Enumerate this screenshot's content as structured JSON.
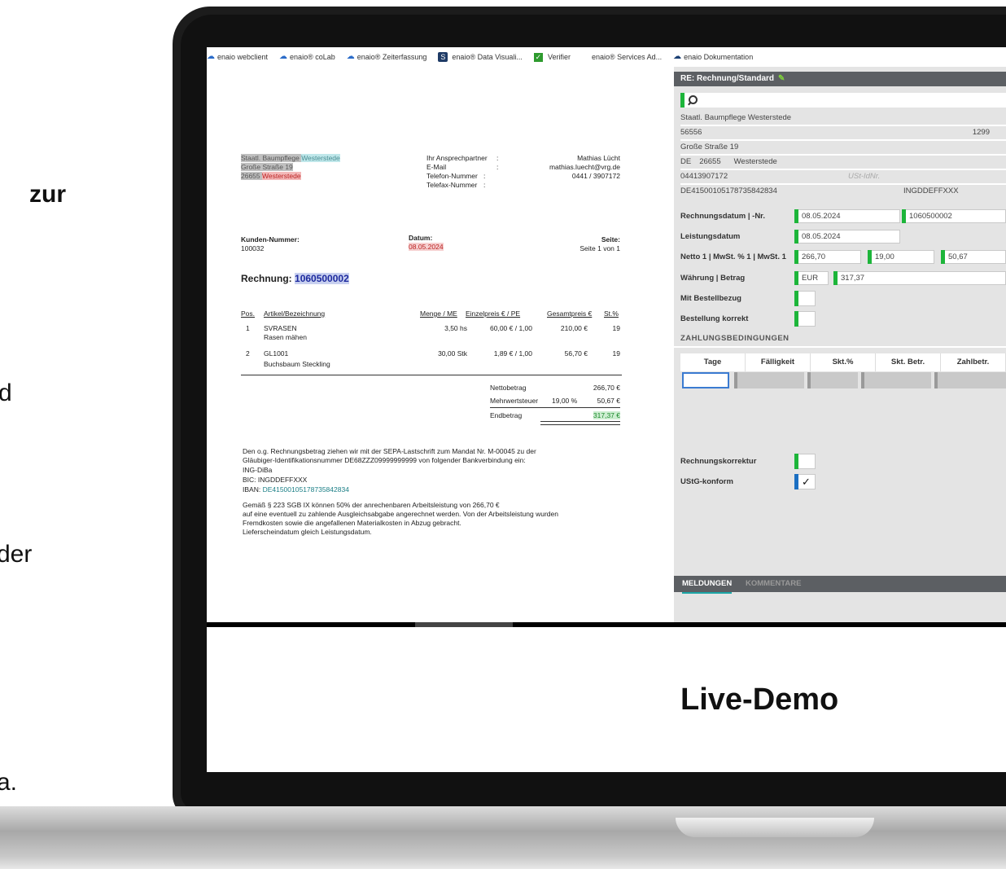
{
  "slide_fragments": [
    "zur",
    "d",
    "der",
    "a."
  ],
  "bookmarks": [
    {
      "label": "enaio webclient",
      "icon": "enaio-icon"
    },
    {
      "label": "enaio® coLab",
      "icon": "enaio-icon"
    },
    {
      "label": "enaio® Zeiterfassung",
      "icon": "enaio-icon"
    },
    {
      "label": "enaio® Data Visuali...",
      "icon": "data-visualization-icon"
    },
    {
      "label": "Verifier",
      "icon": "check-icon"
    },
    {
      "label": "enaio® Services Ad...",
      "icon": "none"
    },
    {
      "label": "enaio Dokumentation",
      "icon": "enaio-icon"
    }
  ],
  "document": {
    "sender": {
      "line1_a": "Staatl. Baumpflege ",
      "line1_b": "Westerstede",
      "line2": "Große Straße 19",
      "line3_a": "26655 ",
      "line3_b": "Westerstede"
    },
    "contact_labels": {
      "partner": "Ihr Ansprechpartner",
      "email": "E-Mail",
      "phone": "Telefon-Nummer",
      "fax": "Telefax-Nummer",
      "colon": ":"
    },
    "contact_values": {
      "partner": "Mathias Lücht",
      "email": "mathias.luecht@vrg.de",
      "phone": "0441 / 3907172"
    },
    "customer_label": "Kunden-Nummer:",
    "customer_value": "100032",
    "date_label": "Datum:",
    "date_value": "08.05.2024",
    "page_label": "Seite:",
    "page_value": "Seite 1 von 1",
    "invoice_label": "Rechnung:",
    "invoice_number": "1060500002",
    "table_headers": {
      "pos": "Pos.",
      "article": "Artikel/Bezeichnung",
      "qty": "Menge / ME",
      "unit_price": "Einzelpreis € / PE",
      "total": "Gesamtpreis €",
      "tax": "St.%"
    },
    "items": [
      {
        "pos": "1",
        "article": "SVRASEN",
        "desc": "Rasen mähen",
        "qty": "3,50 hs",
        "unit_price": "60,00 € / 1,00",
        "total": "210,00 €",
        "tax": "19"
      },
      {
        "pos": "2",
        "article": "GL1001",
        "desc": "Buchsbaum Steckling",
        "qty": "30,00 Stk",
        "unit_price": "1,89 € / 1,00",
        "total": "56,70 €",
        "tax": "19"
      }
    ],
    "totals": {
      "net_label": "Nettobetrag",
      "net_value": "266,70 €",
      "vat_label": "Mehrwertsteuer",
      "vat_rate": "19,00 %",
      "vat_value": "50,67 €",
      "end_label": "Endbetrag",
      "end_value": "317,37 €"
    },
    "footer": {
      "l1": "Den o.g. Rechnungsbetrag ziehen wir mit der SEPA-Lastschrift zum Mandat Nr. M-00045 zu der",
      "l2": "Gläubiger-Identifikationsnummer DE68ZZZ09999999999 von folgender Bankverbindung ein:",
      "l3": "ING-DiBa",
      "l4": "BIC: INGDDEFFXXX",
      "l5_label": "IBAN: ",
      "l5_value": "DE41500105178735842834",
      "l6": "Gemäß § 223 SGB IX können 50% der anrechenbaren Arbeitsleistung von 266,70 €",
      "l7": "auf eine eventuell zu zahlende Ausgleichsabgabe angerechnet werden. Von der Arbeitsleistung wurden",
      "l8": "Fremdkosten sowie die angefallenen Materialkosten in Abzug gebracht.",
      "l9": "Lieferscheindatum gleich Leistungsdatum."
    }
  },
  "panel": {
    "title": "RE: Rechnung/Standard",
    "vendor_name": "Staatl. Baumpflege Westerstede",
    "vendor_id": "56556",
    "vendor_id2": "1299",
    "street": "Große Straße 19",
    "country": "DE",
    "zip": "26655",
    "city": "Westerstede",
    "phone": "04413907172",
    "vat_id_placeholder": "USt-IdNr.",
    "iban": "DE41500105178735842834",
    "bic": "INGDDEFFXXX",
    "labels": {
      "invoice_date_no": "Rechnungsdatum | -Nr.",
      "service_date": "Leistungsdatum",
      "net_vat": "Netto 1 | MwSt. % 1 | MwSt. 1",
      "currency_amount": "Währung | Betrag",
      "order_ref": "Mit Bestellbezug",
      "order_ok": "Bestellung korrekt",
      "payment_terms": "ZAHLUNGSBEDINGUNGEN",
      "correction": "Rechnungskorrektur",
      "ustg": "UStG-konform"
    },
    "values": {
      "invoice_date": "08.05.2024",
      "invoice_no": "1060500002",
      "service_date": "08.05.2024",
      "net": "266,70",
      "vat_rate": "19,00",
      "vat": "50,67",
      "currency": "EUR",
      "amount": "317,37"
    },
    "terms_headers": [
      "Tage",
      "Fälligkeit",
      "Skt.%",
      "Skt. Betr.",
      "Zahlbetr."
    ],
    "ustg_check": "✓",
    "tabs": [
      "MELDUNGEN",
      "KOMMENTARE"
    ]
  },
  "live_demo": "Live-Demo"
}
